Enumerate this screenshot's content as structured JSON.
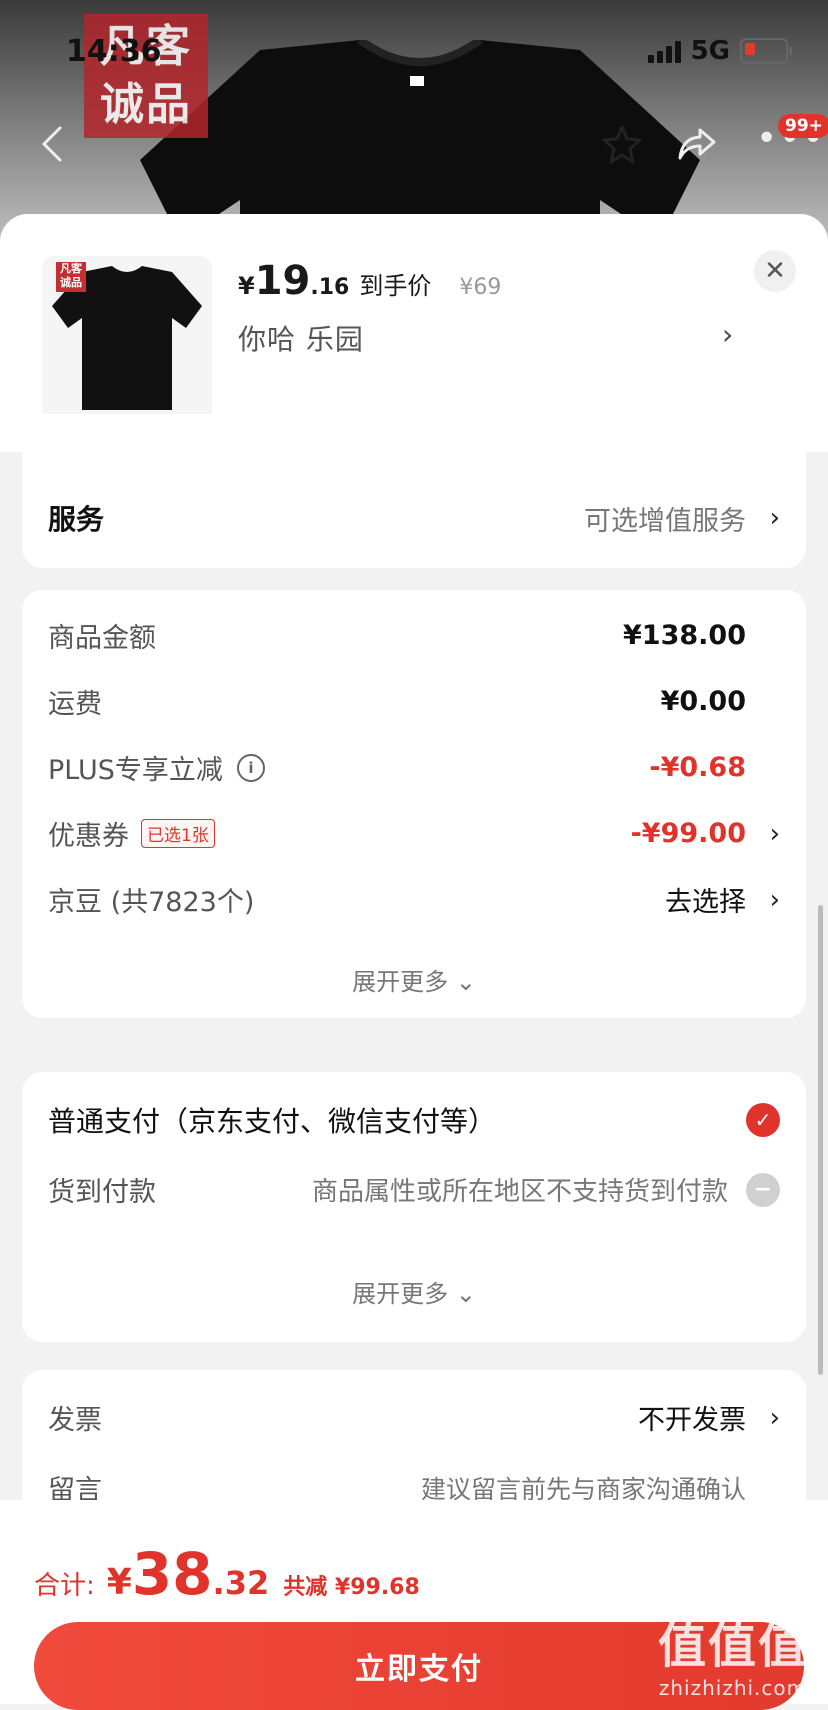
{
  "status_bar": {
    "time": "14:36",
    "network": "5G"
  },
  "hero": {
    "logo_line1": "凡客",
    "logo_line2": "诚品",
    "cart_badge": "99+",
    "icons": [
      "back-icon",
      "star-icon",
      "share-icon",
      "more-icon"
    ]
  },
  "product": {
    "price_yen": "¥",
    "price_int": "19",
    "price_dec": ".16",
    "price_tag": "到手价",
    "original_price": "¥69",
    "variant": "你哈  乐园",
    "thumb_logo": "凡客诚品"
  },
  "service": {
    "label": "服务",
    "value": "可选增值服务"
  },
  "costs": {
    "items_label": "商品金额",
    "items_value": "¥138.00",
    "shipping_label": "运费",
    "shipping_value": "¥0.00",
    "plus_label": "PLUS专享立减",
    "plus_value": "-¥0.68",
    "coupon_label": "优惠券",
    "coupon_tag": "已选1张",
    "coupon_value": "-¥99.00",
    "beans_label": "京豆 (共7823个)",
    "beans_value": "去选择",
    "expand": "展开更多"
  },
  "payment": {
    "normal_label": "普通支付（京东支付、微信支付等）",
    "cod_label": "货到付款",
    "cod_note": "商品属性或所在地区不支持货到付款",
    "expand": "展开更多"
  },
  "extra": {
    "invoice_label": "发票",
    "invoice_value": "不开发票",
    "note_label": "留言",
    "note_placeholder": "建议留言前先与商家沟通确认"
  },
  "footer": {
    "total_label": "合计:",
    "total_yen": "¥",
    "total_int": "38",
    "total_dec": ".32",
    "total_saved": "共减 ¥99.68",
    "pay_button": "立即支付"
  },
  "watermark": {
    "big": "值值值",
    "small": "zhizhizhi.com"
  },
  "colors": {
    "accent": "#e0332c",
    "card": "#ffffff",
    "background": "#f2f2f2"
  }
}
